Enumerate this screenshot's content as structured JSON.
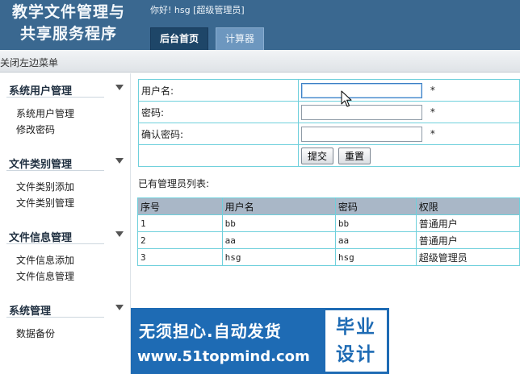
{
  "header": {
    "app_title_line1": "教学文件管理与",
    "app_title_line2": "共享服务程序",
    "greeting": "你好! hsg [超级管理员]",
    "tabs": [
      {
        "label": "后台首页",
        "active": true
      },
      {
        "label": "计算器",
        "active": false
      }
    ]
  },
  "toolbar": {
    "close_menu_label": "关闭左边菜单"
  },
  "sidebar": {
    "groups": [
      {
        "title": "系统用户管理",
        "items": [
          "系统用户管理",
          "修改密码"
        ]
      },
      {
        "title": "文件类别管理",
        "items": [
          "文件类别添加",
          "文件类别管理"
        ]
      },
      {
        "title": "文件信息管理",
        "items": [
          "文件信息添加",
          "文件信息管理"
        ]
      },
      {
        "title": "系统管理",
        "items": [
          "数据备份"
        ]
      }
    ]
  },
  "form": {
    "username_label": "用户名:",
    "username_value": "",
    "password_label": "密码:",
    "password_value": "",
    "confirm_label": "确认密码:",
    "confirm_value": "",
    "required_mark": "*",
    "submit_label": "提交",
    "reset_label": "重置"
  },
  "admin_list": {
    "title": "已有管理员列表:",
    "columns": [
      "序号",
      "用户名",
      "密码",
      "权限"
    ],
    "rows": [
      [
        "1",
        "bb",
        "bb",
        "普通用户"
      ],
      [
        "2",
        "aa",
        "aa",
        "普通用户"
      ],
      [
        "3",
        "hsg",
        "hsg",
        "超级管理员"
      ]
    ]
  },
  "watermark": {
    "slogan": "无须担心.自动发货",
    "site": "www.51topmind.com",
    "badge_line1": "毕业",
    "badge_line2": "设计"
  },
  "colors": {
    "header_bg": "#3a6890",
    "tab_active_bg": "#1e4668",
    "tab_inactive_bg": "#6d97bf",
    "table_border": "#6fd0dc",
    "table_header_bg": "#a9b7c7",
    "banner_blue": "#1e6bb4"
  }
}
